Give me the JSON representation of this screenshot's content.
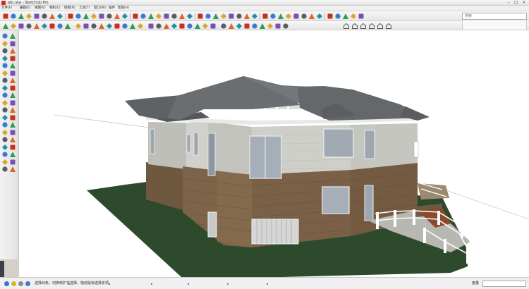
{
  "window": {
    "title": "abc.skp - SketchUp Pro"
  },
  "menu": {
    "items": [
      "文件(F)",
      "编辑(E)",
      "视图(V)",
      "相机(C)",
      "绘图(R)",
      "工具(T)",
      "窗口(W)",
      "插件",
      "帮助(H)"
    ]
  },
  "search": {
    "placeholder": "搜索"
  },
  "status": {
    "text": "选择对象。切换到扩充选择。拖动鼠标选择多项。",
    "measure_label": "度量",
    "measure_value": ""
  },
  "icons": {
    "toolbar1": [
      "select-icon",
      "eraser-icon",
      "paint-icon",
      "rectangle-icon",
      "line-icon",
      "circle-icon",
      "arc-icon",
      "move-icon",
      "push-pull-icon",
      "rotate-icon",
      "follow-me-icon",
      "scale-icon",
      "offset-icon",
      "tape-icon",
      "dimension-icon",
      "protractor-icon",
      "text-icon",
      "axes-icon",
      "3d-text-icon",
      "orbit-icon",
      "pan-icon",
      "zoom-icon",
      "zoom-window-icon",
      "zoom-extents-icon",
      "previous-icon",
      "next-icon",
      "new-icon",
      "open-icon",
      "save-icon",
      "cut-icon",
      "copy-icon",
      "paste-icon",
      "delete-icon",
      "undo-icon",
      "redo-icon",
      "print-icon",
      "model-info-icon"
    ],
    "toolbar2": [
      "iso-view-icon",
      "top-view-icon",
      "front-view-icon",
      "right-view-icon",
      "back-view-icon",
      "left-view-icon"
    ]
  },
  "colors": {
    "ground": "#2d4a2c",
    "roof": "#6b6e70",
    "siding": "#c9c9c3",
    "stone": "#7c6246",
    "window_glass": "#9fa7b0",
    "accent_red": "#c8301c"
  }
}
